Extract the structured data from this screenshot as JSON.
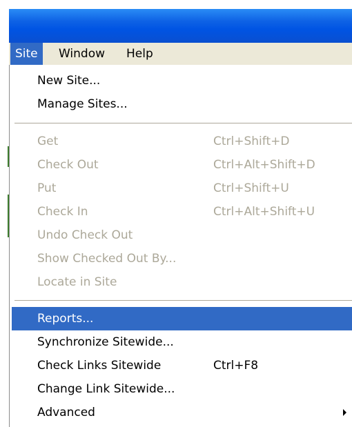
{
  "menubar": {
    "items": [
      {
        "label": "Site",
        "active": true
      },
      {
        "label": "Window",
        "active": false
      },
      {
        "label": "Help",
        "active": false
      }
    ]
  },
  "site_menu": {
    "new_site": "New Site...",
    "manage_sites": "Manage Sites...",
    "get": {
      "label": "Get",
      "shortcut": "Ctrl+Shift+D"
    },
    "check_out": {
      "label": "Check Out",
      "shortcut": "Ctrl+Alt+Shift+D"
    },
    "put": {
      "label": "Put",
      "shortcut": "Ctrl+Shift+U"
    },
    "check_in": {
      "label": "Check In",
      "shortcut": "Ctrl+Alt+Shift+U"
    },
    "undo_check_out": "Undo Check Out",
    "show_checked_out_by": "Show Checked Out By...",
    "locate_in_site": "Locate in Site",
    "reports": "Reports...",
    "synchronize_sitewide": "Synchronize Sitewide...",
    "check_links_sitewide": {
      "label": "Check Links Sitewide",
      "shortcut": "Ctrl+F8"
    },
    "change_link_sitewide": "Change Link Sitewide...",
    "advanced": "Advanced"
  },
  "colors": {
    "highlight": "#316ac5",
    "disabled_text": "#aca899",
    "menubar_bg": "#ece9d8",
    "titlebar": "#0054e3"
  },
  "icons": {
    "submenu_arrow": "submenu-arrow-icon"
  }
}
